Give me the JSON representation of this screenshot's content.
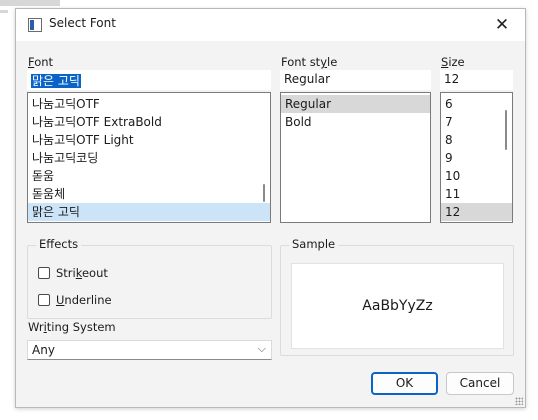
{
  "window": {
    "title": "Select Font",
    "close_glyph": "✕"
  },
  "font": {
    "label_mnemonic": "F",
    "label_rest": "ont",
    "value": "맑은 고딕",
    "items": [
      "나눔고딕OTF",
      "나눔고딕OTF ExtraBold",
      "나눔고딕OTF Light",
      "나눔고딕코딩",
      "돋움",
      "돋움체",
      "맑은 고딕"
    ],
    "selected_index": 6
  },
  "style": {
    "label_pre": "Font st",
    "label_mnemonic": "y",
    "label_post": "le",
    "value": "Regular",
    "items": [
      "Regular",
      "Bold"
    ],
    "selected_index": 0
  },
  "size": {
    "label_mnemonic": "S",
    "label_rest": "ize",
    "value": "12",
    "items": [
      "6",
      "7",
      "8",
      "9",
      "10",
      "11",
      "12"
    ],
    "selected_index": 6
  },
  "effects": {
    "title": "Effects",
    "strikeout": {
      "label_pre": "Stri",
      "label_mnemonic": "k",
      "label_post": "eout",
      "checked": false
    },
    "underline": {
      "label_mnemonic": "U",
      "label_post": "nderline",
      "checked": false
    }
  },
  "writing_system": {
    "label_pre": "Wr",
    "label_mnemonic": "i",
    "label_post": "ting System",
    "value": "Any",
    "arrow_glyph": "⌵"
  },
  "sample": {
    "title": "Sample",
    "text": "AaBbYyZz"
  },
  "buttons": {
    "ok": "OK",
    "cancel": "Cancel"
  },
  "colors": {
    "accent": "#0a64c8",
    "dialog_bg": "#f3f3f3",
    "font_selection": "#cce4f7",
    "list_selection": "#d8d8d8"
  },
  "icons": {
    "app": "window-app-icon",
    "close": "close-icon",
    "dropdown": "chevron-down-icon",
    "resize": "resize-grip-icon"
  }
}
